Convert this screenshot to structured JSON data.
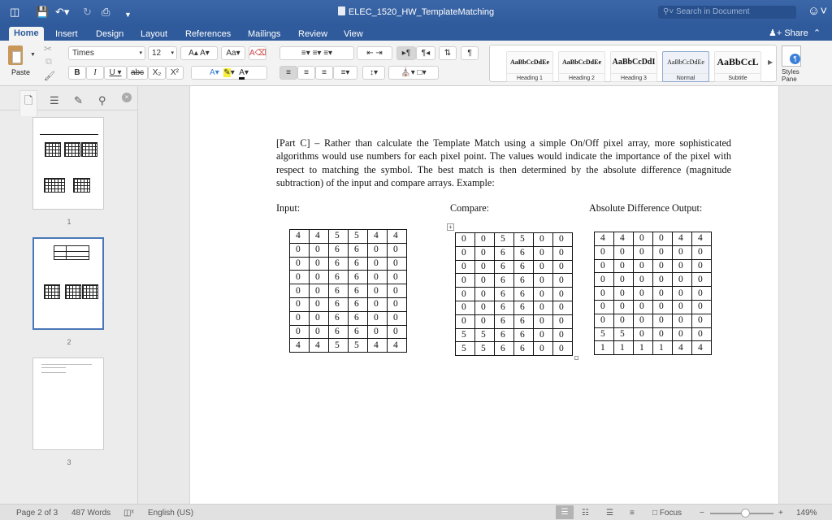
{
  "titlebar": {
    "title": "ELEC_1520_HW_TemplateMatching",
    "search_placeholder": "Search in Document",
    "quick_access": [
      "sidebar-toggle-icon",
      "save-icon",
      "undo-icon",
      "redo-icon",
      "print-icon",
      "customize-icon"
    ]
  },
  "tabs": [
    {
      "label": "Home",
      "active": true
    },
    {
      "label": "Insert"
    },
    {
      "label": "Design"
    },
    {
      "label": "Layout"
    },
    {
      "label": "References"
    },
    {
      "label": "Mailings"
    },
    {
      "label": "Review"
    },
    {
      "label": "View"
    }
  ],
  "share_label": "Share",
  "ribbon": {
    "paste_label": "Paste",
    "font_name": "Times",
    "font_size": "12",
    "styles": [
      {
        "preview": "AaBbCcDdEe",
        "name": "Heading 1"
      },
      {
        "preview": "AaBbCcDdEe",
        "name": "Heading 2"
      },
      {
        "preview": "AaBbCcDdI",
        "name": "Heading 3"
      },
      {
        "preview": "AaBbCcDdEe",
        "name": "Normal",
        "selected": true
      },
      {
        "preview": "AaBbCcL",
        "name": "Subtitle"
      }
    ],
    "styles_pane_label": "Styles Pane"
  },
  "sidebar": {
    "pages": [
      "1",
      "2",
      "3"
    ],
    "current_page": "2"
  },
  "document": {
    "paragraph": "[Part C] – Rather than calculate the Template Match using a simple On/Off pixel array, more sophisticated algorithms would use numbers for each pixel point.  The values would indicate the importance of the pixel with respect to matching the symbol.  The best match is then determined by the absolute difference (magnitude subtraction) of the input and compare arrays. Example:",
    "labels": {
      "input": "Input:",
      "compare": "Compare:",
      "output": "Absolute Difference Output:"
    },
    "input": [
      [
        4,
        4,
        5,
        5,
        4,
        4
      ],
      [
        0,
        0,
        6,
        6,
        0,
        0
      ],
      [
        0,
        0,
        6,
        6,
        0,
        0
      ],
      [
        0,
        0,
        6,
        6,
        0,
        0
      ],
      [
        0,
        0,
        6,
        6,
        0,
        0
      ],
      [
        0,
        0,
        6,
        6,
        0,
        0
      ],
      [
        0,
        0,
        6,
        6,
        0,
        0
      ],
      [
        0,
        0,
        6,
        6,
        0,
        0
      ],
      [
        4,
        4,
        5,
        5,
        4,
        4
      ]
    ],
    "compare": [
      [
        0,
        0,
        5,
        5,
        0,
        0
      ],
      [
        0,
        0,
        6,
        6,
        0,
        0
      ],
      [
        0,
        0,
        6,
        6,
        0,
        0
      ],
      [
        0,
        0,
        6,
        6,
        0,
        0
      ],
      [
        0,
        0,
        6,
        6,
        0,
        0
      ],
      [
        0,
        0,
        6,
        6,
        0,
        0
      ],
      [
        0,
        0,
        6,
        6,
        0,
        0
      ],
      [
        5,
        5,
        6,
        6,
        0,
        0
      ],
      [
        5,
        5,
        6,
        6,
        0,
        0
      ]
    ],
    "output": [
      [
        4,
        4,
        0,
        0,
        4,
        4
      ],
      [
        0,
        0,
        0,
        0,
        0,
        0
      ],
      [
        0,
        0,
        0,
        0,
        0,
        0
      ],
      [
        0,
        0,
        0,
        0,
        0,
        0
      ],
      [
        0,
        0,
        0,
        0,
        0,
        0
      ],
      [
        0,
        0,
        0,
        0,
        0,
        0
      ],
      [
        0,
        0,
        0,
        0,
        0,
        0
      ],
      [
        5,
        5,
        0,
        0,
        0,
        0
      ],
      [
        1,
        1,
        1,
        1,
        4,
        4
      ]
    ]
  },
  "status": {
    "page": "Page 2 of 3",
    "words": "487 Words",
    "language": "English (US)",
    "focus": "Focus",
    "zoom": "149%"
  }
}
